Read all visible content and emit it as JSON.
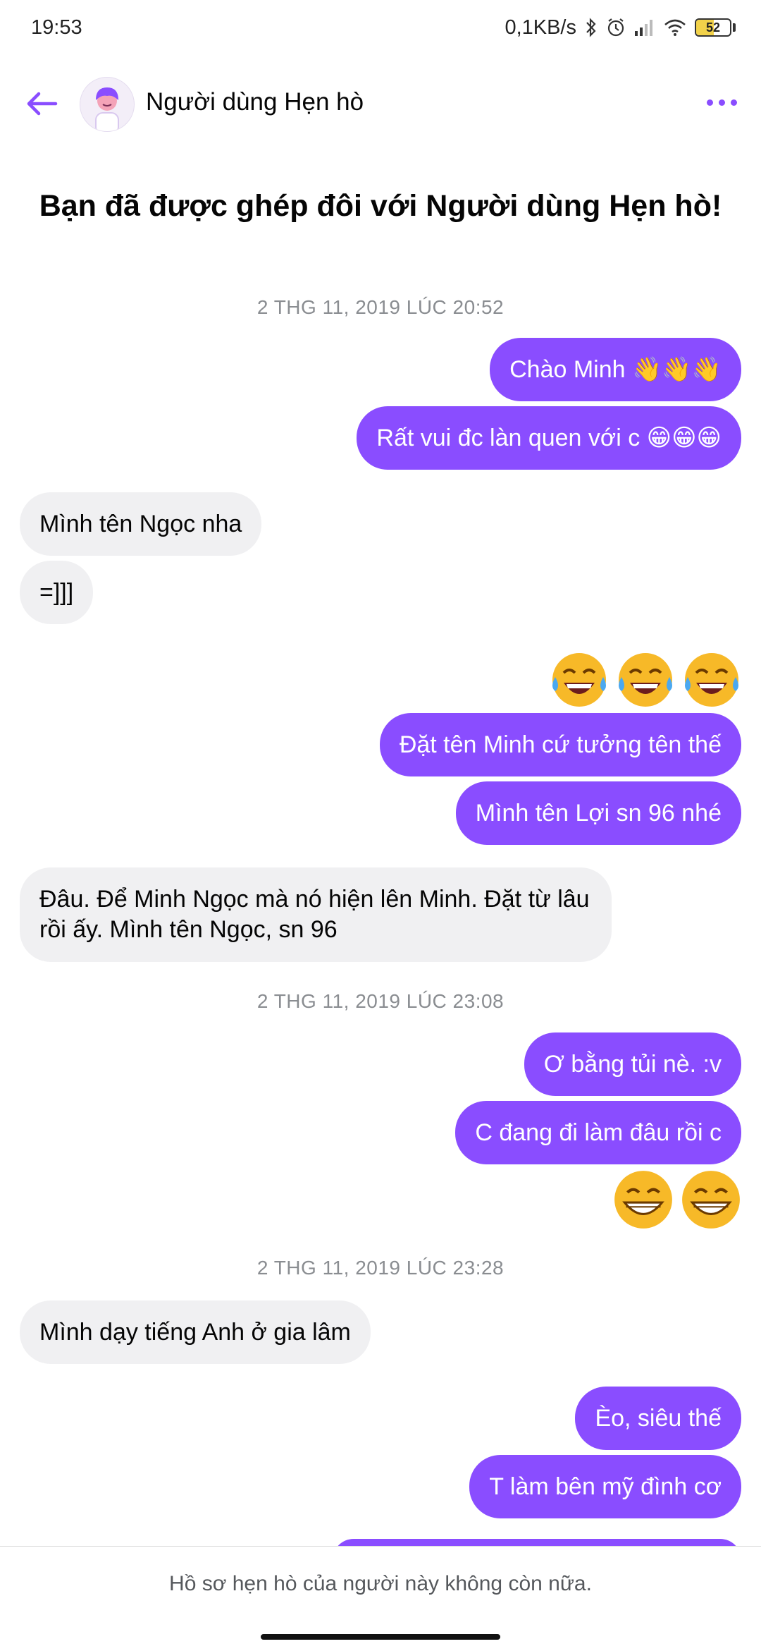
{
  "status_bar": {
    "time": "19:53",
    "network_speed": "0,1KB/s",
    "battery": "52",
    "battery_level": 0.52
  },
  "header": {
    "contact_name": "Người dùng Hẹn hò",
    "accent_color": "#8a4dff"
  },
  "match_banner": "Bạn đã được ghép đôi với Người dùng Hẹn hò!",
  "timestamps": [
    "2 THG 11, 2019 LÚC 20:52",
    "2 THG 11, 2019 LÚC 23:08",
    "2 THG 11, 2019 LÚC 23:28"
  ],
  "messages": [
    {
      "side": "sent",
      "text": "Chào Minh 👋👋👋"
    },
    {
      "side": "sent",
      "text": "Rất vui đc làn quen với c 😁😁😁"
    },
    {
      "side": "received",
      "text": "Mình tên Ngọc nha"
    },
    {
      "side": "received",
      "text": "=]]]"
    },
    {
      "side": "sent",
      "text": "😂😂😂"
    },
    {
      "side": "sent",
      "text": "Đặt tên Minh cứ tưởng tên thế"
    },
    {
      "side": "sent",
      "text": "Mình tên Lợi sn 96 nhé"
    },
    {
      "side": "received",
      "text": "Đâu. Để Minh Ngọc mà nó hiện lên Minh. Đặt từ lâu rồi ấy. Mình tên Ngọc, sn 96"
    },
    {
      "side": "sent",
      "text": "Ơ bằng tủi nè. :v"
    },
    {
      "side": "sent",
      "text": "C đang đi làm đâu rồi c"
    },
    {
      "side": "sent",
      "text": "😁😁"
    },
    {
      "side": "received",
      "text": "Mình dạy tiếng Anh ở gia lâm"
    },
    {
      "side": "sent",
      "text": "Èo, siêu thế"
    },
    {
      "side": "sent",
      "text": "T làm bên mỹ đình cơ"
    }
  ],
  "footer": {
    "notice": "Hồ sơ hẹn hò của người này không còn nữa."
  }
}
